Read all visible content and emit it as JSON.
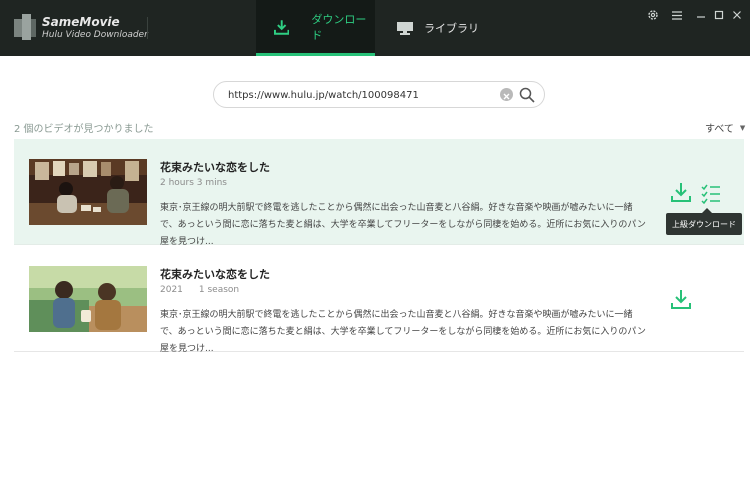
{
  "app": {
    "brand_name": "SameMovie",
    "brand_subtitle": "Hulu Video Downloader"
  },
  "tabs": [
    {
      "label": "ダウンロード",
      "icon": "download-icon",
      "active": true
    },
    {
      "label": "ライブラリ",
      "icon": "monitor-icon",
      "active": false
    }
  ],
  "window_controls": [
    "gear-icon",
    "menu-icon",
    "minimize-icon",
    "maximize-icon",
    "close-icon"
  ],
  "search": {
    "value": "https://www.hulu.jp/watch/100098471",
    "placeholder": ""
  },
  "results": {
    "count_text": "2 個のビデオが見つかりました",
    "filter_label": "すべて"
  },
  "videos": [
    {
      "title": "花束みたいな恋をした",
      "meta": [
        "2 hours 3 mins"
      ],
      "description": "東京･京王線の明大前駅で終電を逃したことから偶然に出会った山音麦と八谷絹。好きな音楽や映画が嘘みたいに一緒で、あっという間に恋に落ちた麦と絹は、大学を卒業してフリーターをしながら同棲を始める。近所にお気に入りのパン屋を見つけ...",
      "highlighted": true
    },
    {
      "title": "花束みたいな恋をした",
      "meta": [
        "2021",
        "1 season"
      ],
      "description": "東京･京王線の明大前駅で終電を逃したことから偶然に出会った山音麦と八谷絹。好きな音楽や映画が嘘みたいに一緒で、あっという間に恋に落ちた麦と絹は、大学を卒業してフリーターをしながら同棲を始める。近所にお気に入りのパン屋を見つけ...",
      "highlighted": false
    }
  ],
  "tooltip": "上級ダウンロード",
  "colors": {
    "accent": "#27c178",
    "titlebar": "#1f2522",
    "row_highlight": "#e9f5ef"
  }
}
